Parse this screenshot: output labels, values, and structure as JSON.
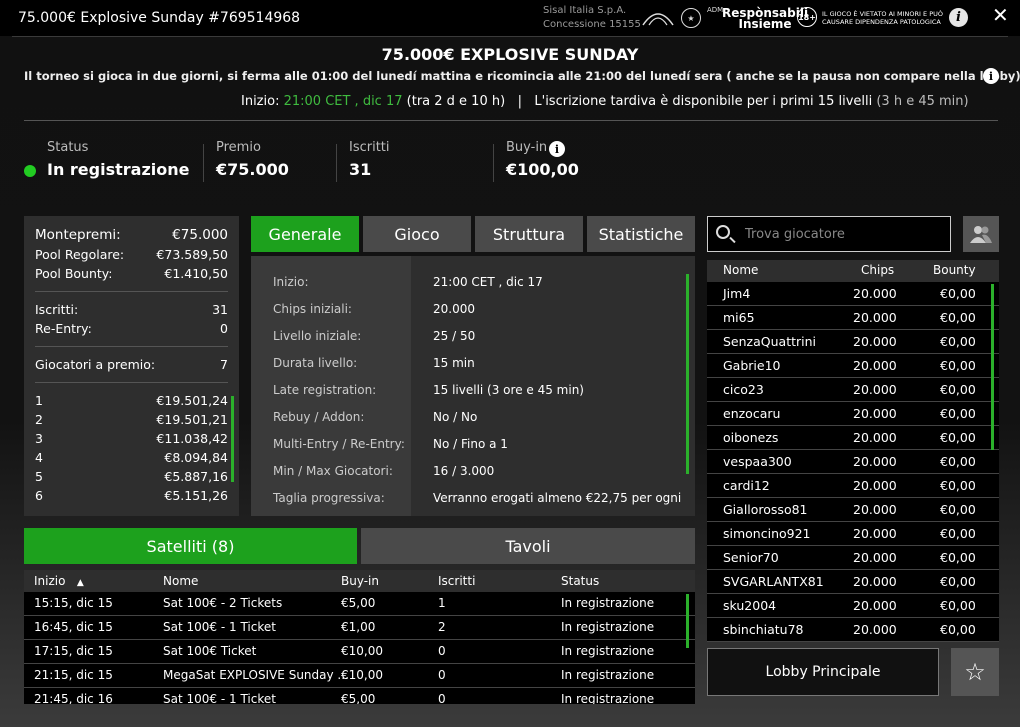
{
  "window": {
    "title": "75.000€ Explosive Sunday #769514968"
  },
  "brand": {
    "company": "Sisal Italia S.p.A.",
    "license": "Concessione 15155",
    "adm_label": "ADM",
    "rg_line1": "Respònsabili",
    "rg_line2": "Insieme",
    "age": "18+",
    "warning_line1": "IL GIOCO È VIETATO AI MINORI E PUÒ",
    "warning_line2": "CAUSARE DIPENDENZA PATOLOGICA"
  },
  "tournament": {
    "name": "75.000€ EXPLOSIVE SUNDAY",
    "note": "Il torneo si gioca in due giorni, si ferma alle 01:00 del lunedí mattina e ricomincia alle 21:00 del lunedí sera ( anche se la pausa non compare nella lobby)....",
    "start_label": "Inizio: ",
    "start_time": "21:00 CET , dic 17",
    "start_countdown": " (tra 2 d e 10 h)",
    "late_reg_sep": "|",
    "late_reg": "L'iscrizione tardiva è disponibile per i primi 15 livelli",
    "late_reg_time": " (3 h e 45 min)"
  },
  "stats": {
    "status_label": "Status",
    "status_value": "In registrazione",
    "prize_label": "Premio",
    "prize_value": "€75.000",
    "entrants_label": "Iscritti",
    "entrants_value": "31",
    "buyin_label": "Buy-in",
    "buyin_value": "€100,00"
  },
  "prize_panel": {
    "montepremi_label": "Montepremi:",
    "montepremi_value": "€75.000",
    "pool_reg_label": "Pool Regolare:",
    "pool_reg_value": "€73.589,50",
    "pool_bounty_label": "Pool Bounty:",
    "pool_bounty_value": "€1.410,50",
    "iscritti_label": "Iscritti:",
    "iscritti_value": "31",
    "reentry_label": "Re-Entry:",
    "reentry_value": "0",
    "paid_label": "Giocatori a premio:",
    "paid_value": "7",
    "places": [
      {
        "pos": "1",
        "amount": "€19.501,24"
      },
      {
        "pos": "2",
        "amount": "€19.501,21"
      },
      {
        "pos": "3",
        "amount": "€11.038,42"
      },
      {
        "pos": "4",
        "amount": "€8.094,84"
      },
      {
        "pos": "5",
        "amount": "€5.887,16"
      },
      {
        "pos": "6",
        "amount": "€5.151,26"
      }
    ]
  },
  "tabs": [
    "Generale",
    "Gioco",
    "Struttura",
    "Statistiche"
  ],
  "general": [
    {
      "label": "Inizio:",
      "value": "21:00 CET , dic 17"
    },
    {
      "label": "Chips iniziali:",
      "value": "20.000"
    },
    {
      "label": "Livello iniziale:",
      "value": "25 / 50"
    },
    {
      "label": "Durata livello:",
      "value": "15 min"
    },
    {
      "label": "Late registration:",
      "value": "15 livelli (3 ore e 45 min)"
    },
    {
      "label": "Rebuy / Addon:",
      "value": "No / No"
    },
    {
      "label": "Multi-Entry / Re-Entry:",
      "value": "No / Fino a 1"
    },
    {
      "label": "Min / Max Giocatori:",
      "value": "16 / 3.000"
    },
    {
      "label": "Taglia progressiva:",
      "value": "Verranno erogati almeno €22,75 per ogni"
    }
  ],
  "search": {
    "placeholder": "Trova giocatore"
  },
  "players": {
    "headers": {
      "name": "Nome",
      "chips": "Chips",
      "bounty": "Bounty"
    },
    "rows": [
      {
        "name": "Jim4",
        "chips": "20.000",
        "bounty": "€0,00"
      },
      {
        "name": "mi65",
        "chips": "20.000",
        "bounty": "€0,00"
      },
      {
        "name": "SenzaQuattrini",
        "chips": "20.000",
        "bounty": "€0,00"
      },
      {
        "name": "Gabrie10",
        "chips": "20.000",
        "bounty": "€0,00"
      },
      {
        "name": "cico23",
        "chips": "20.000",
        "bounty": "€0,00"
      },
      {
        "name": "enzocaru",
        "chips": "20.000",
        "bounty": "€0,00"
      },
      {
        "name": "oibonezs",
        "chips": "20.000",
        "bounty": "€0,00"
      },
      {
        "name": "vespaa300",
        "chips": "20.000",
        "bounty": "€0,00"
      },
      {
        "name": "cardi12",
        "chips": "20.000",
        "bounty": "€0,00"
      },
      {
        "name": "Giallorosso81",
        "chips": "20.000",
        "bounty": "€0,00"
      },
      {
        "name": "simoncino921",
        "chips": "20.000",
        "bounty": "€0,00"
      },
      {
        "name": "Senior70",
        "chips": "20.000",
        "bounty": "€0,00"
      },
      {
        "name": "SVGARLANTX81",
        "chips": "20.000",
        "bounty": "€0,00"
      },
      {
        "name": "sku2004",
        "chips": "20.000",
        "bounty": "€0,00"
      },
      {
        "name": "sbinchiatu78",
        "chips": "20.000",
        "bounty": "€0,00"
      }
    ]
  },
  "satellites": {
    "tab_satelliti": "Satelliti (8)",
    "tab_tavoli": "Tavoli",
    "headers": {
      "start": "Inizio",
      "sort_arrow": "▲",
      "name": "Nome",
      "buyin": "Buy-in",
      "entrants": "Iscritti",
      "status": "Status"
    },
    "rows": [
      {
        "start": "15:15, dic 15",
        "name": "Sat 100€ - 2 Tickets",
        "buyin": "€5,00",
        "entrants": "1",
        "status": "In registrazione"
      },
      {
        "start": "16:45, dic 15",
        "name": "Sat 100€ - 1 Ticket",
        "buyin": "€1,00",
        "entrants": "2",
        "status": "In registrazione"
      },
      {
        "start": "17:15, dic 15",
        "name": "Sat 100€ Ticket",
        "buyin": "€10,00",
        "entrants": "0",
        "status": "In registrazione"
      },
      {
        "start": "21:15, dic 15",
        "name": "MegaSat EXPLOSIVE Sunday ...",
        "buyin": "€10,00",
        "entrants": "0",
        "status": "In registrazione"
      },
      {
        "start": "21:45, dic 16",
        "name": "Sat 100€ - 1 Ticket",
        "buyin": "€5,00",
        "entrants": "0",
        "status": "In registrazione"
      }
    ]
  },
  "buttons": {
    "lobby": "Lobby Principale"
  },
  "colors": {
    "accent_green": "#1da11d",
    "status_green": "#22cc22",
    "highlight_green": "#3fbb3f"
  }
}
